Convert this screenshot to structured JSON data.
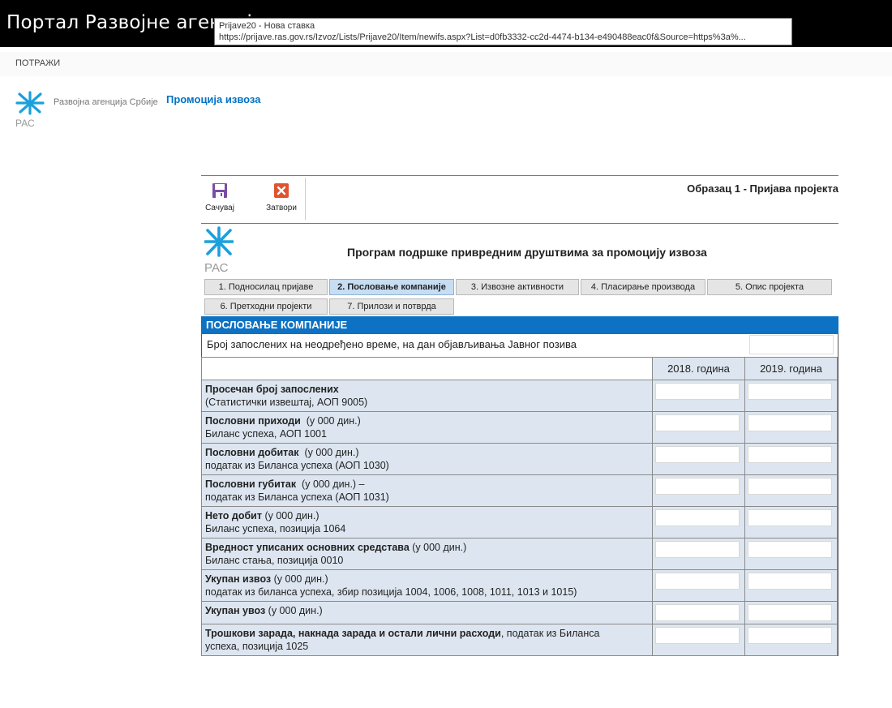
{
  "portal": {
    "title": "Портал Развојне агенције"
  },
  "tooltip": {
    "line1": "Prijave20 - Нова ставка",
    "line2": "https://prijave.ras.gov.rs/Izvoz/Lists/Prijave20/Item/newifs.aspx?List=d0fb3332-cc2d-4474-b134-e490488eac0f&Source=https%3a%..."
  },
  "search": {
    "label": "ПОТРАЖИ"
  },
  "site": {
    "name": "Развојна агенција Србије",
    "logo_text": "РАС",
    "nav": "Промоција извоза"
  },
  "ribbon": {
    "save_label": "Сачувај",
    "close_label": "Затвори"
  },
  "form": {
    "title": "Образац 1 - Пријава пројекта",
    "heading": "Програм подршке привредним друштвима за промоцију извоза",
    "logo_text": "РАС"
  },
  "tabs": [
    {
      "label": "1. Подносилац пријаве",
      "active": false
    },
    {
      "label": "2. Пословање компаније",
      "active": true
    },
    {
      "label": "3. Извозне активности",
      "active": false
    },
    {
      "label": "4. Пласирање производа",
      "active": false
    },
    {
      "label": "5. Опис пројекта",
      "active": false
    },
    {
      "label": "6. Претходни пројекти",
      "active": false
    },
    {
      "label": "7. Прилози и потврда",
      "active": false
    }
  ],
  "section": {
    "title": "ПОСЛОВАЊЕ КОМПАНИЈЕ",
    "employees_label": "Број запослених на неодређено време, на дан објављивања Јавног позива",
    "employees_value": ""
  },
  "table": {
    "columns": [
      "2018. година",
      "2019. година"
    ],
    "rows": [
      {
        "bold": "Просечан број запослених",
        "rest": "",
        "sub": "(Статистички извештај, АОП 9005)",
        "v2018": "",
        "v2019": ""
      },
      {
        "bold": "Пословни приходи",
        "rest": "  (у 000 дин.)",
        "sub": "Биланс успеха, АОП 1001",
        "v2018": "",
        "v2019": ""
      },
      {
        "bold": "Пословни добитак",
        "rest": "  (у 000 дин.)",
        "sub": "податак из Биланса успеха (АОП 1030)",
        "v2018": "",
        "v2019": ""
      },
      {
        "bold": "Пословни губитак",
        "rest": "  (у 000 дин.) –",
        "sub": "податак из Биланса успеха (АОП 1031)",
        "v2018": "",
        "v2019": ""
      },
      {
        "bold": "Нето добит",
        "rest": " (у 000 дин.)",
        "sub": "Биланс успеха, позиција 1064",
        "v2018": "",
        "v2019": ""
      },
      {
        "bold": "Вредност уписаних основних средстава",
        "rest": " (у 000 дин.)",
        "sub": "Биланс стања, позиција 0010",
        "v2018": "",
        "v2019": ""
      },
      {
        "bold": "Укупан извоз",
        "rest": " (у 000 дин.)",
        "sub": "податак из биланса успеха, збир позиција 1004, 1006, 1008, 1011, 1013 и 1015)",
        "v2018": "",
        "v2019": ""
      },
      {
        "bold": "Укупан увоз",
        "rest": " (у 000 дин.)",
        "sub": "",
        "v2018": "",
        "v2019": ""
      },
      {
        "bold": "Трошкови зарада, накнада зарада и остали лични расходи",
        "rest": ", податак из Биланса",
        "sub": "успеха, позиција 1025",
        "v2018": "",
        "v2019": ""
      }
    ]
  },
  "colors": {
    "accent": "#0d72c3",
    "tab_active": "#c6ddf2",
    "row_bg": "#dde6f0",
    "ribbon_line": "#8e65a8",
    "save_icon": "#7a4fa3",
    "close_icon": "#e0532d"
  }
}
